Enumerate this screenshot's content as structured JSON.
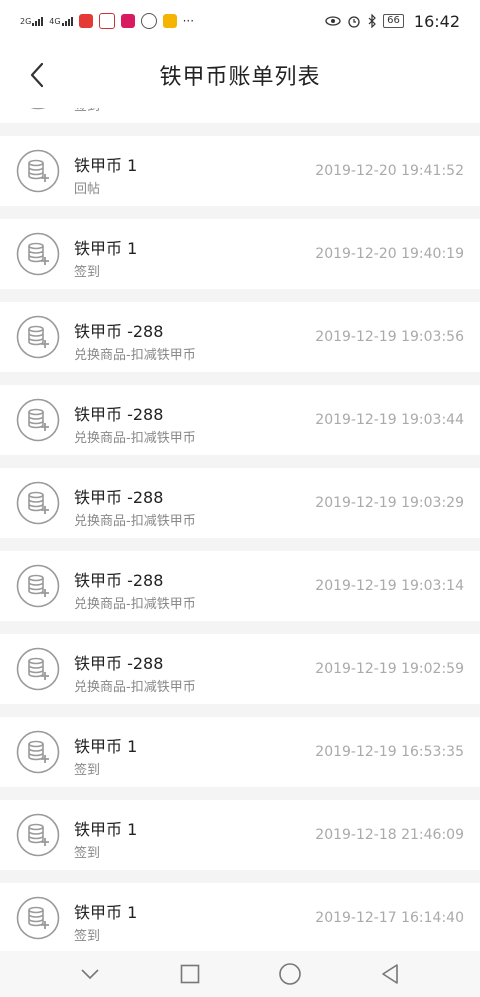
{
  "status_bar": {
    "net1": "2G",
    "net2": "4G",
    "more": "···",
    "battery": "66",
    "time": "16:42"
  },
  "header": {
    "title": "铁甲币账单列表"
  },
  "list": {
    "partial_row": {
      "desc": "签到"
    },
    "items": [
      {
        "amount": "铁甲币 1",
        "desc": "回帖",
        "time": "2019-12-20 19:41:52"
      },
      {
        "amount": "铁甲币 1",
        "desc": "签到",
        "time": "2019-12-20 19:40:19"
      },
      {
        "amount": "铁甲币 -288",
        "desc": "兑换商品-扣减铁甲币",
        "time": "2019-12-19 19:03:56"
      },
      {
        "amount": "铁甲币 -288",
        "desc": "兑换商品-扣减铁甲币",
        "time": "2019-12-19 19:03:44"
      },
      {
        "amount": "铁甲币 -288",
        "desc": "兑换商品-扣减铁甲币",
        "time": "2019-12-19 19:03:29"
      },
      {
        "amount": "铁甲币 -288",
        "desc": "兑换商品-扣减铁甲币",
        "time": "2019-12-19 19:03:14"
      },
      {
        "amount": "铁甲币 -288",
        "desc": "兑换商品-扣减铁甲币",
        "time": "2019-12-19 19:02:59"
      },
      {
        "amount": "铁甲币 1",
        "desc": "签到",
        "time": "2019-12-19 16:53:35"
      },
      {
        "amount": "铁甲币 1",
        "desc": "签到",
        "time": "2019-12-18 21:46:09"
      },
      {
        "amount": "铁甲币 1",
        "desc": "签到",
        "time": "2019-12-17 16:14:40"
      }
    ]
  },
  "colors": {
    "icon_stroke": "#9a9a9a",
    "separator": "#f4f4f4"
  }
}
